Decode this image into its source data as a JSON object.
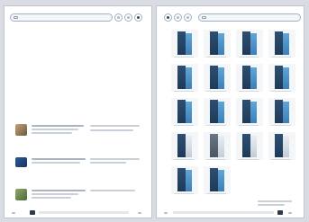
{
  "colors": {
    "background": "#d9dde3",
    "page": "#ffffff",
    "accent_blue": "#3d7fb8",
    "dark_navy": "#1f3a58"
  },
  "left_page": {
    "nav_icons": [
      "tab-icon",
      "nav-circle-icon",
      "nav-circle-icon",
      "nav-circle-icon"
    ]
  },
  "right_page": {
    "nav_icons": [
      "tab-icon",
      "nav-circle-icon",
      "nav-circle-icon",
      "nav-circle-icon"
    ],
    "product_tiles_count_hint": "grid"
  }
}
